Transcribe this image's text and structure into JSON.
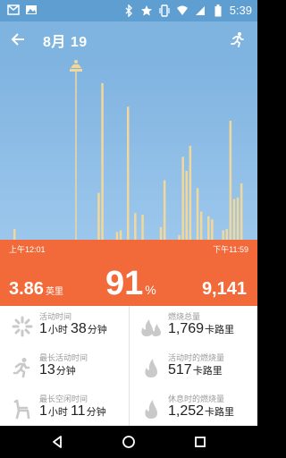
{
  "status_bar": {
    "time": "5:39",
    "icons_left": [
      "mail-icon",
      "image-icon"
    ],
    "icons_right": [
      "bluetooth-icon",
      "star-icon",
      "vibrate-icon",
      "wifi-icon",
      "signal-icon",
      "battery-icon"
    ]
  },
  "app_bar": {
    "title": "8月 19",
    "back_icon": "arrow-left-icon",
    "action_icon": "runner-icon"
  },
  "colors": {
    "status_bar": "#5f9ed1",
    "app_bar": "#7fb3e0",
    "chart_bg": "#8ebfe8",
    "bar": "#f2d79a",
    "goal_line": "#f2d79a",
    "summary_bg": "#f26a3a",
    "icon_gray": "#c9c9c9"
  },
  "chart_data": {
    "type": "bar",
    "title": "",
    "xlabel": "",
    "ylabel": "",
    "x_start_label": "上午12:01",
    "x_end_label": "下午11:59",
    "values": [
      0.07,
      0,
      0,
      0,
      0,
      0,
      0,
      0,
      0,
      0,
      0,
      0,
      0,
      0,
      0,
      0,
      0,
      0,
      0,
      0,
      0,
      0,
      0,
      0.3,
      1.0,
      0,
      0,
      0,
      0.05,
      0.06,
      0,
      0.85,
      0,
      0.17,
      0,
      0.16,
      0,
      0,
      0,
      0,
      0.08,
      0.38,
      0,
      0,
      0,
      0.03,
      0.53,
      0.44,
      0.6,
      0,
      0.33,
      0.18,
      0,
      0.15,
      0.13,
      0,
      0,
      0.06,
      0.07,
      0.76,
      0.26,
      0.27,
      0.36
    ],
    "ylim": [
      0,
      1
    ],
    "goal_marker": true
  },
  "summary": {
    "time_start": "上午12:01",
    "time_end": "下午11:59",
    "distance_value": "3.86",
    "distance_unit": "英里",
    "percent_value": "91",
    "percent_sign": "%",
    "steps": "9,141"
  },
  "metrics": {
    "active_time": {
      "label": "活动时间",
      "value_html_parts": [
        "1",
        "小时 ",
        "38",
        "分钟"
      ],
      "icon": "sparkle-icon"
    },
    "longest_active": {
      "label": "最长活动时间",
      "value_parts": [
        "13",
        "分钟"
      ],
      "icon": "runner-icon"
    },
    "longest_idle": {
      "label": "最长空闲时间",
      "value_parts": [
        "1",
        "小时 ",
        "11",
        "分钟"
      ],
      "icon": "chair-icon"
    },
    "total_burn": {
      "label": "燃烧总量",
      "value_parts": [
        "1,769",
        "卡路里"
      ],
      "icon": "flame-double-icon"
    },
    "active_burn": {
      "label": "活动时的燃烧量",
      "value_parts": [
        "517",
        "卡路里"
      ],
      "icon": "flame-icon"
    },
    "rest_burn": {
      "label": "休息时的燃烧量",
      "value_parts": [
        "1,252",
        "卡路里"
      ],
      "icon": "flame-icon"
    }
  },
  "nav": [
    "back-triangle-icon",
    "home-circle-icon",
    "recents-square-icon"
  ]
}
